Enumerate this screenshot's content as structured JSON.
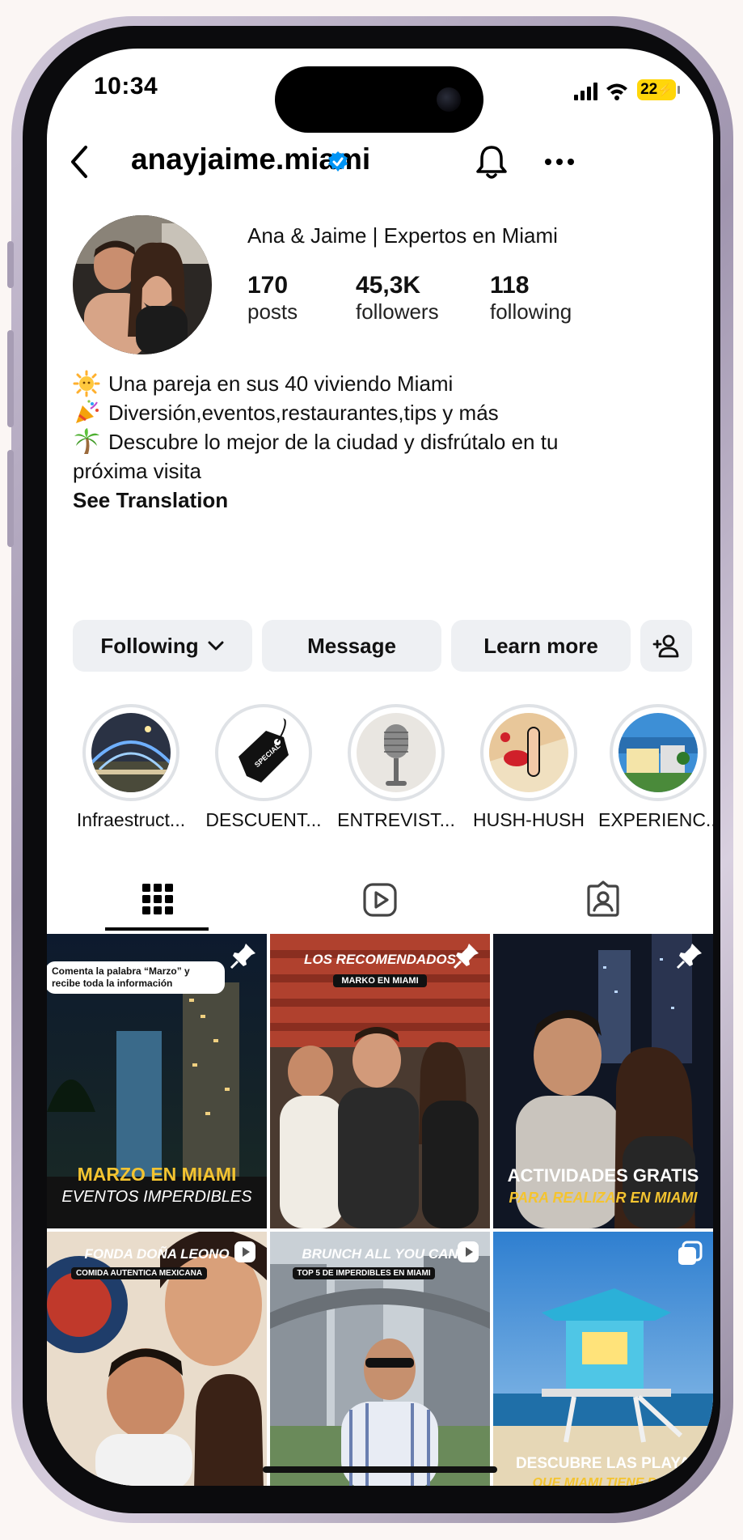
{
  "status_bar": {
    "time": "10:34",
    "battery": "22"
  },
  "header": {
    "username": "anayjaime.miami"
  },
  "profile": {
    "full_name": "Ana & Jaime | Expertos en Miami",
    "stats": [
      {
        "value": "170",
        "label": "posts"
      },
      {
        "value": "45,3K",
        "label": "followers"
      },
      {
        "value": "118",
        "label": "following"
      }
    ],
    "bio": [
      "Una pareja en sus 40 viviendo Miami",
      "Diversión,eventos,restaurantes,tips y más",
      "Descubre lo mejor de la ciudad y disfrútalo en tu",
      "próxima visita"
    ],
    "see_translation": "See Translation"
  },
  "actions": {
    "following": "Following",
    "message": "Message",
    "learn_more": "Learn more"
  },
  "highlights": [
    {
      "label": "Infraestruct..."
    },
    {
      "label": "DESCUENT..."
    },
    {
      "label": "ENTREVIST..."
    },
    {
      "label": "HUSH-HUSH"
    },
    {
      "label": "EXPERIENC..."
    }
  ],
  "posts": [
    {
      "top": "Comenta la palabra “Marzo” y recibe toda la información",
      "title": "MARZO EN MIAMI",
      "subtitle": "EVENTOS IMPERDIBLES"
    },
    {
      "top": "LOS RECOMENDADOS",
      "tag": "MARKO EN MIAMI"
    },
    {
      "title": "ACTIVIDADES GRATIS",
      "subtitle": "PARA REALIZAR EN MIAMI"
    },
    {
      "top": "FONDA DOÑA LEONO",
      "tag": "COMIDA AUTENTICA MEXICANA"
    },
    {
      "top": "BRUNCH ALL YOU CAN",
      "tag": "TOP 5 DE IMPERDIBLES EN MIAMI"
    },
    {
      "title": "DESCUBRE LAS PLAYA",
      "subtitle": "QUE MIAMI TIENE PAR"
    }
  ],
  "colors": {
    "verified": "#0095f6",
    "button_bg": "#eef0f3",
    "battery": "#ffd60a"
  }
}
